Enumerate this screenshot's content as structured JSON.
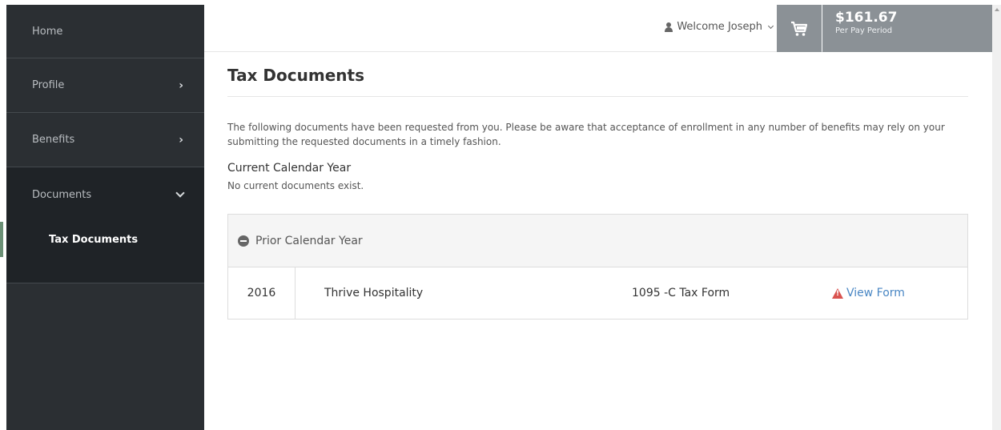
{
  "sidebar": {
    "items": [
      {
        "label": "Home"
      },
      {
        "label": "Profile"
      },
      {
        "label": "Benefits"
      },
      {
        "label": "Documents"
      }
    ],
    "subitems": [
      {
        "label": "Tax Documents",
        "active": true
      }
    ]
  },
  "header": {
    "welcome": "Welcome Joseph",
    "cart": {
      "amount": "$161.67",
      "period": "Per Pay Period"
    }
  },
  "main": {
    "title": "Tax Documents",
    "intro": "The following documents have been requested from you. Please be aware that acceptance of enrollment in any number of benefits may rely on your submitting the requested documents in a timely fashion.",
    "current": {
      "title": "Current Calendar Year",
      "empty": "No current documents exist."
    },
    "prior": {
      "title": "Prior Calendar Year",
      "rows": [
        {
          "year": "2016",
          "employer": "Thrive Hospitality",
          "form": "1095 -C Tax Form",
          "action": "View Form"
        }
      ]
    }
  },
  "colors": {
    "sidebar": "#2b2f33",
    "accent": "#8b9196",
    "link": "#4a87c4",
    "warning": "#d9534f"
  }
}
